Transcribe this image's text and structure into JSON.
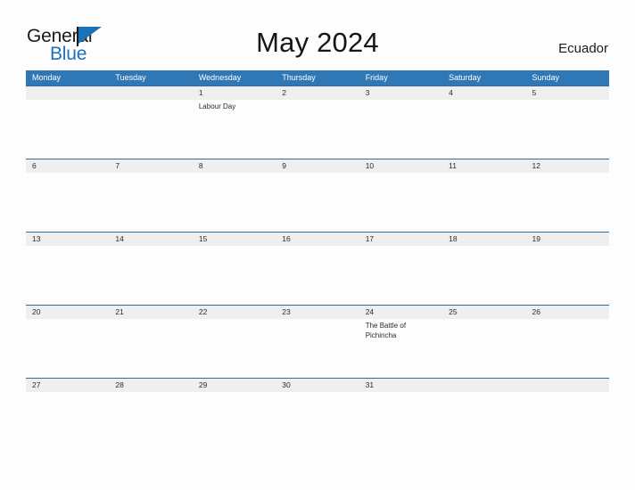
{
  "header": {
    "logo": {
      "word_top": "General",
      "word_bottom": "Blue"
    },
    "title": "May 2024",
    "country": "Ecuador"
  },
  "calendar": {
    "weekdays": [
      "Monday",
      "Tuesday",
      "Wednesday",
      "Thursday",
      "Friday",
      "Saturday",
      "Sunday"
    ],
    "colors": {
      "header_blue": "#3077b5",
      "date_band_gray": "#efefef",
      "row_border_blue": "#2e6da4",
      "logo_blue": "#1e6fbc"
    },
    "weeks": [
      {
        "days": [
          {
            "date": "",
            "event": ""
          },
          {
            "date": "",
            "event": ""
          },
          {
            "date": "1",
            "event": "Labour Day"
          },
          {
            "date": "2",
            "event": ""
          },
          {
            "date": "3",
            "event": ""
          },
          {
            "date": "4",
            "event": ""
          },
          {
            "date": "5",
            "event": ""
          }
        ]
      },
      {
        "days": [
          {
            "date": "6",
            "event": ""
          },
          {
            "date": "7",
            "event": ""
          },
          {
            "date": "8",
            "event": ""
          },
          {
            "date": "9",
            "event": ""
          },
          {
            "date": "10",
            "event": ""
          },
          {
            "date": "11",
            "event": ""
          },
          {
            "date": "12",
            "event": ""
          }
        ]
      },
      {
        "days": [
          {
            "date": "13",
            "event": ""
          },
          {
            "date": "14",
            "event": ""
          },
          {
            "date": "15",
            "event": ""
          },
          {
            "date": "16",
            "event": ""
          },
          {
            "date": "17",
            "event": ""
          },
          {
            "date": "18",
            "event": ""
          },
          {
            "date": "19",
            "event": ""
          }
        ]
      },
      {
        "days": [
          {
            "date": "20",
            "event": ""
          },
          {
            "date": "21",
            "event": ""
          },
          {
            "date": "22",
            "event": ""
          },
          {
            "date": "23",
            "event": ""
          },
          {
            "date": "24",
            "event": "The Battle of Pichincha"
          },
          {
            "date": "25",
            "event": ""
          },
          {
            "date": "26",
            "event": ""
          }
        ]
      },
      {
        "days": [
          {
            "date": "27",
            "event": ""
          },
          {
            "date": "28",
            "event": ""
          },
          {
            "date": "29",
            "event": ""
          },
          {
            "date": "30",
            "event": ""
          },
          {
            "date": "31",
            "event": ""
          },
          {
            "date": "",
            "event": ""
          },
          {
            "date": "",
            "event": ""
          }
        ]
      }
    ]
  }
}
